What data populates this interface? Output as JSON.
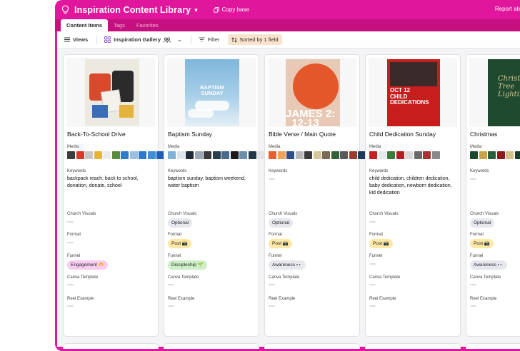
{
  "app": {
    "title": "Inspiration Content Library",
    "copy_label": "Copy base",
    "report_label": "Report ab"
  },
  "tabs": [
    {
      "label": "Content Items",
      "active": true
    },
    {
      "label": "Tags",
      "active": false
    },
    {
      "label": "Favorites",
      "active": false
    }
  ],
  "toolbar": {
    "views_label": "Views",
    "view_name": "Inspiration Gallery",
    "filter_label": "Filter",
    "sort_label": "Sorted by 1 field"
  },
  "field_labels": {
    "media": "Media",
    "keywords": "Keywords",
    "church_visuals": "Church Visuals",
    "format": "Format",
    "funnel": "Funnel",
    "canva_template": "Canva Template",
    "reel_example": "Reel Example"
  },
  "colors": {
    "brand": "#e0179d",
    "tab_bar": "#c5117f",
    "sort_chip": "#fbe2cd"
  },
  "cards": [
    {
      "title": "Back-To-School Drive",
      "keywords": "backpack reach, back to school, donation, donate, school",
      "church_visuals": "",
      "format": "",
      "funnel": "Engagement 🫶",
      "funnel_style": "pink",
      "thumb_text": "You're making an impact!",
      "media_colors": [
        "#3c3c3c",
        "#d8392b",
        "#c7c7c7",
        "#e8b23c",
        "#ececec",
        "#5b8a3a",
        "#2f7cc8",
        "#9bc0de",
        "#2f78c9",
        "#3b8fd8",
        "#1e5fb5",
        "#5aa0e0",
        "#2a6cc0"
      ]
    },
    {
      "title": "Baptism Sunday",
      "keywords": "baptism sunday, baptism weekend, water baptism",
      "church_visuals": "Optional",
      "format": "Post 📸",
      "funnel": "Discipleship 🌱",
      "funnel_style": "green",
      "thumb_text": "BAPTISM SUNDAY",
      "media_colors": [
        "#7fb3d5",
        "#dde6ee",
        "#1f2a36",
        "#9aa7b5",
        "#3b3b3b",
        "#2c3e50",
        "#4a6a8a",
        "#1b1b1b",
        "#6d8fae",
        "#24384d",
        "#e3e3e3",
        "#3d5a73"
      ]
    },
    {
      "title": "Bible Verse / Main Quote",
      "keywords": "",
      "church_visuals": "Optional",
      "format": "Post 📸",
      "funnel": "Awareness 👀",
      "funnel_style": "gray",
      "thumb_text": "JAMES 2: 12-13",
      "media_colors": [
        "#e8612c",
        "#f0a35b",
        "#2b4f8c",
        "#b8b8b8",
        "#3a3a3a",
        "#d9c59a",
        "#7a6a53",
        "#355e3b",
        "#5a5a5a",
        "#9a3e2b",
        "#1f3b5a",
        "#7d8c9b",
        "#d44b2a"
      ]
    },
    {
      "title": "Child Dedication Sunday",
      "keywords": "child dedication, children dedication, baby dedication, newborn dedication, kid dedication",
      "church_visuals": "",
      "format": "Post 📸",
      "funnel": "",
      "funnel_style": "",
      "thumb_text": "OCT 12 CHILD DEDICATIONS",
      "media_colors": [
        "#c81f1f",
        "#e8e8e8",
        "#3a7a3a",
        "#b02020",
        "#d9d9d9",
        "#6a6a6a",
        "#a83232",
        "#8a8a8a"
      ]
    },
    {
      "title": "Christmas",
      "keywords": "",
      "church_visuals": "Optional",
      "format": "Post 📸",
      "funnel": "Awareness 👀",
      "funnel_style": "gray",
      "thumb_text": "Christmas Tree Lighting",
      "media_colors": [
        "#1d4a2f",
        "#c9a24a",
        "#2a5e3a",
        "#8b1c1c",
        "#d6c08a",
        "#1a3d27",
        "#b33030",
        "#e3d2a0"
      ]
    }
  ]
}
